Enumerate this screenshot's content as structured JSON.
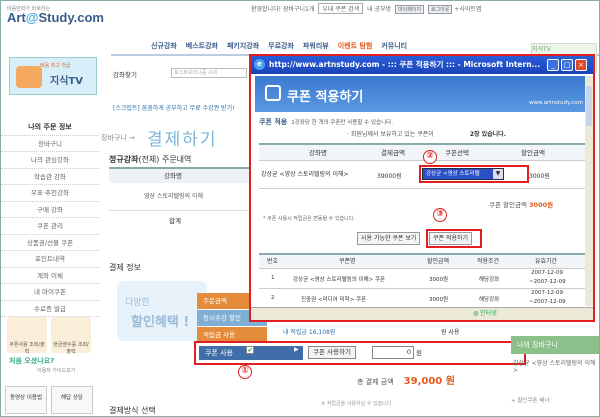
{
  "header": {
    "logo_small": "마음만화가 바로하는",
    "logo_main": "Art",
    "logo_at": "@",
    "logo_end": "Study.com",
    "greeting": "환영합니다!",
    "cart": "장바구니1개",
    "search_select": "우대 쿠폰 검색",
    "my_study": "내 공부방",
    "btn_mypage": "마이페이지",
    "btn_logout": "로그아웃",
    "sitemap": "+사이트맵"
  },
  "nav": {
    "items": [
      "신규강좌",
      "베스트강좌",
      "패키지강좌",
      "무료강좌",
      "파워리뷰",
      "이벤트 탐험",
      "커뮤니티"
    ]
  },
  "left": {
    "tv_sub": "배움 최고 학급",
    "tv_title": "지식TV",
    "sidebar_items": [
      "나의 주문 정보",
      "장바구니",
      "나의 관심강좌",
      "학습관 강좌",
      "우표·추천강좌",
      "구매 강좌",
      "쿠폰 관리",
      "상품권/선물 쿠폰",
      "포인트내역",
      "계좌 이체",
      "내 마이쿠폰",
      "수료증 발급"
    ],
    "icon1": "쿠폰사용 조회/출력",
    "icon2": "현금영수증 조회/출력",
    "first_time": "처음 오셨나요?",
    "first_time_sub": "이용자 가이드보기",
    "bottom1": "동영상 이용법",
    "bottom2": "해답 상담"
  },
  "main": {
    "lecture_label": "강좌찾기",
    "search_placeholder": "포스트모더니즘 시대",
    "notice": "[스크립트] 꼼꼼하게 공부하고 무료 수강권 받기!",
    "crumb": "장바구니 →",
    "title": "결제하기",
    "order_section": "정규강좌",
    "order_section_tail": "(전체) 주문내역",
    "table_header": "강좌명",
    "table_row": "영상 스토리텔링의 이해",
    "table_sum": "합계",
    "payment_section": "결제 정보",
    "promo_line1": "다양한",
    "promo_line2": "할인혜택 !",
    "paylines": [
      "주문금액",
      "동시수강 할인",
      "적립금 사용"
    ],
    "points_text": "내 적립금 16,108원",
    "points_use": "원 사용",
    "coupon_label": "쿠폰 사용",
    "coupon_check": "✔",
    "coupon_arrow": "▶",
    "coupon_btn": "쿠폰 사용하기",
    "coupon_value": "0",
    "coupon_won": "원",
    "total_label": "총 결제 금액",
    "total_value": "39,000 원",
    "footnote": "※ 적립금을 사용하실 수 있습니다",
    "method_section": "결제방식 선택"
  },
  "right": {
    "box_text": "지식TV",
    "cart_title": "나의 장바구니",
    "cart_item": "강상균 <영상 스토리텔링의 이해>",
    "bottom": "+ 할인쿠폰 배너"
  },
  "popup": {
    "title": "http://www.artnstudy.com - ::: 쿠폰 적용하기 ::: - Microsoft Intern...",
    "banner_title": "쿠폰 적용하기",
    "banner_url": "www.artnstudy.com",
    "line1_b": "쿠폰 적용",
    "line1_s": "1강좌당 한 개의 쿠폰만 사용할 수 있습니다.",
    "line2": "· 회원님께서 보유하고 있는 쿠폰이",
    "line2_count": "2장 있습니다.",
    "t1_headers": [
      "강좌명",
      "결제금액",
      "쿠폰선택",
      "할인금액"
    ],
    "t1_row": {
      "name": "강상균 <영상 스토리텔링의 이해>",
      "price": "39000원",
      "coupon": "강상균 <영상 스토리텔",
      "discount": "3000원"
    },
    "discount_label": "쿠폰 할인금액",
    "discount_value": "3000원",
    "note": "* 쿠폰 사용시 적립금은 변동될 수 있습니다.",
    "btn_view": "사용 가능한 쿠폰 보기",
    "btn_apply": "쿠폰 적용하기",
    "t2_headers": [
      "번호",
      "쿠폰명",
      "할인금액",
      "적용조건",
      "유효기간"
    ],
    "t2_rows": [
      {
        "no": "1",
        "name": "강상균 <영상 스토리텔링의 이해> 쿠폰",
        "amount": "3000원",
        "cond": "해당강좌",
        "date1": "2007-12-09",
        "date2": "~2007-12-09"
      },
      {
        "no": "2",
        "name": "진중권 <미디어 미학> 쿠폰",
        "amount": "3000원",
        "cond": "해당강좌",
        "date1": "2007-12-09",
        "date2": "~2007-12-09"
      }
    ],
    "status_zone": "인터넷"
  },
  "markers": [
    "①",
    "②",
    "③"
  ]
}
